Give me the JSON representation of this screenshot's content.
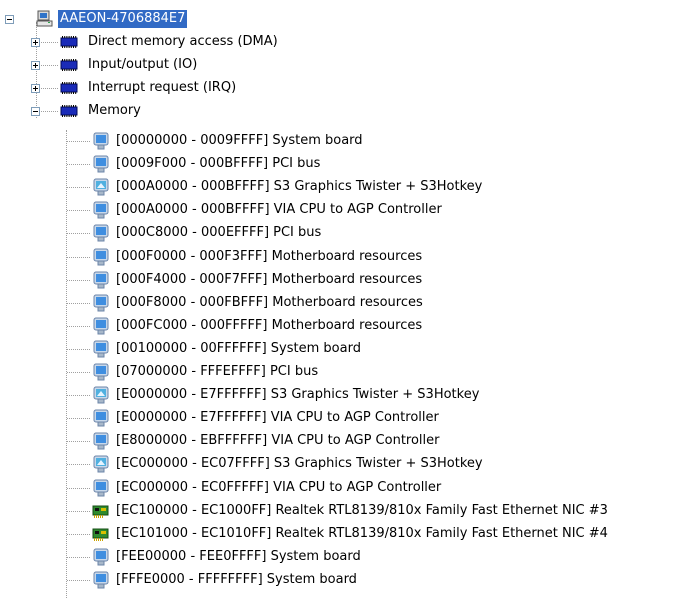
{
  "root": {
    "label": "AAEON-4706884E7",
    "icon": "computer-icon"
  },
  "categories": [
    {
      "label": "Direct memory access (DMA)",
      "icon": "chip-icon",
      "expanded": false
    },
    {
      "label": "Input/output (IO)",
      "icon": "chip-icon",
      "expanded": false
    },
    {
      "label": "Interrupt request (IRQ)",
      "icon": "chip-icon",
      "expanded": false
    },
    {
      "label": "Memory",
      "icon": "chip-icon",
      "expanded": true
    }
  ],
  "memory_items": [
    {
      "label": "[00000000 - 0009FFFF]  System board",
      "icon": "monitor-icon"
    },
    {
      "label": "[0009F000 - 000BFFFF]  PCI bus",
      "icon": "monitor-icon"
    },
    {
      "label": "[000A0000 - 000BFFFF]  S3 Graphics Twister + S3Hotkey",
      "icon": "display-adapter-icon"
    },
    {
      "label": "[000A0000 - 000BFFFF]  VIA CPU to AGP Controller",
      "icon": "monitor-icon"
    },
    {
      "label": "[000C8000 - 000EFFFF]  PCI bus",
      "icon": "monitor-icon"
    },
    {
      "label": "[000F0000 - 000F3FFF]  Motherboard resources",
      "icon": "monitor-icon"
    },
    {
      "label": "[000F4000 - 000F7FFF]  Motherboard resources",
      "icon": "monitor-icon"
    },
    {
      "label": "[000F8000 - 000FBFFF]  Motherboard resources",
      "icon": "monitor-icon"
    },
    {
      "label": "[000FC000 - 000FFFFF]  Motherboard resources",
      "icon": "monitor-icon"
    },
    {
      "label": "[00100000 - 00FFFFFF]  System board",
      "icon": "monitor-icon"
    },
    {
      "label": "[07000000 - FFFEFFFF]  PCI bus",
      "icon": "monitor-icon"
    },
    {
      "label": "[E0000000 - E7FFFFFF]  S3 Graphics Twister + S3Hotkey",
      "icon": "display-adapter-icon"
    },
    {
      "label": "[E0000000 - E7FFFFFF]  VIA CPU to AGP Controller",
      "icon": "monitor-icon"
    },
    {
      "label": "[E8000000 - EBFFFFFF]  VIA CPU to AGP Controller",
      "icon": "monitor-icon"
    },
    {
      "label": "[EC000000 - EC07FFFF]  S3 Graphics Twister + S3Hotkey",
      "icon": "display-adapter-icon"
    },
    {
      "label": "[EC000000 - EC0FFFFF]  VIA CPU to AGP Controller",
      "icon": "monitor-icon"
    },
    {
      "label": "[EC100000 - EC1000FF]  Realtek RTL8139/810x Family Fast Ethernet NIC #3",
      "icon": "network-card-icon"
    },
    {
      "label": "[EC101000 - EC1010FF]  Realtek RTL8139/810x Family Fast Ethernet NIC #4",
      "icon": "network-card-icon"
    },
    {
      "label": "[FEE00000 - FEE0FFFF]  System board",
      "icon": "monitor-icon"
    },
    {
      "label": "[FFFE0000 - FFFFFFFF]  System board",
      "icon": "monitor-icon"
    }
  ],
  "colors": {
    "selection": "#316ac5",
    "tree_lines": "#a0a0a0",
    "expander_border": "#7f9db9"
  }
}
